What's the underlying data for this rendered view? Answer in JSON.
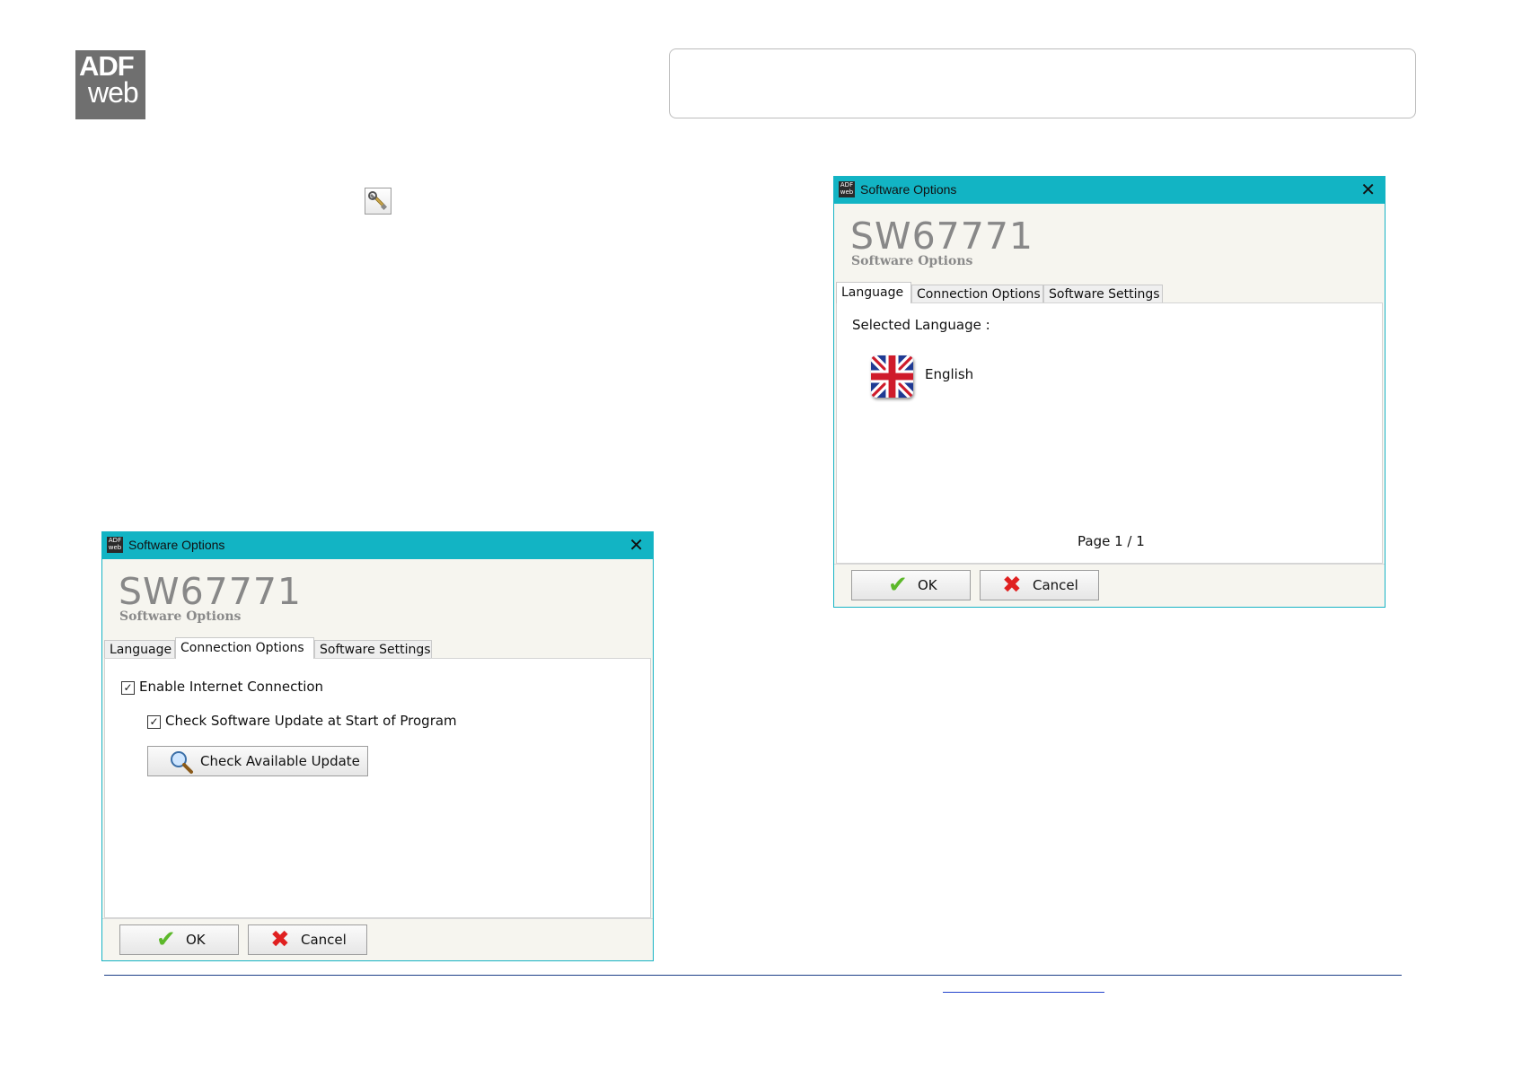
{
  "logo": {
    "line1": "ADF",
    "line2": "web"
  },
  "dialog_options": {
    "window_title": "Software Options",
    "heading": "SW67771",
    "subheading": "Software Options",
    "tabs": [
      "Language",
      "Connection Options",
      "Software Settings"
    ],
    "active_tab": "Connection Options",
    "enable_internet_label": "Enable Internet Connection",
    "enable_internet_checked": true,
    "check_update_start_label": "Check Software Update at Start of Program",
    "check_update_start_checked": true,
    "check_update_button": "Check Available Update",
    "ok_label": "OK",
    "cancel_label": "Cancel"
  },
  "dialog_language": {
    "window_title": "Software Options",
    "heading": "SW67771",
    "subheading": "Software Options",
    "tabs": [
      "Language",
      "Connection Options",
      "Software Settings"
    ],
    "active_tab": "Language",
    "selected_language_label": "Selected Language :",
    "language_name": "English",
    "page_indicator": "Page 1 / 1",
    "ok_label": "OK",
    "cancel_label": "Cancel"
  },
  "colors": {
    "titlebar": "#12b4c4",
    "dialog_bg": "#f6f5ef",
    "heading_gray": "#888888",
    "footer_line": "#1d3f87",
    "ok_check": "#5cb82a",
    "cancel_x": "#e02020"
  },
  "icons": {
    "toolbar": "wrench-icon",
    "ok": "checkmark-icon",
    "cancel": "cross-icon",
    "search": "magnifier-icon",
    "flag": "uk-flag-icon"
  }
}
